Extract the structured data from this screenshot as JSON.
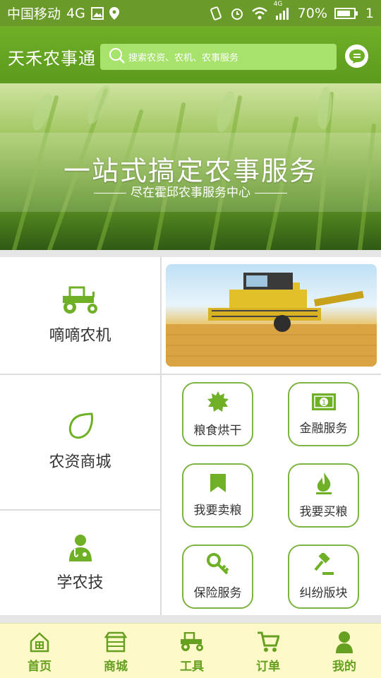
{
  "status_bar": {
    "carrier": "中国移动",
    "network": "4G",
    "network_small": "4G",
    "battery": "70%",
    "time_partial": "1"
  },
  "header": {
    "title": "天禾农事通",
    "search_placeholder": "搜索农资、农机、农事服务"
  },
  "banner": {
    "title": "一站式搞定农事服务",
    "subtitle": "尽在霍邱农事服务中心"
  },
  "categories": [
    {
      "label": "嘀嘀农机",
      "icon": "tractor-icon"
    },
    {
      "label": "农资商城",
      "icon": "lemon-icon"
    },
    {
      "label": "学农技",
      "icon": "doctor-icon"
    }
  ],
  "services": [
    {
      "label": "粮食烘干",
      "icon": "sun-burst-icon"
    },
    {
      "label": "金融服务",
      "icon": "banknote-icon"
    },
    {
      "label": "我要卖粮",
      "icon": "bookmark-icon"
    },
    {
      "label": "我要买粮",
      "icon": "fire-icon"
    },
    {
      "label": "保险服务",
      "icon": "key-icon"
    },
    {
      "label": "纠纷版块",
      "icon": "gavel-icon"
    }
  ],
  "bottom_nav": [
    {
      "label": "首页",
      "icon": "home-icon"
    },
    {
      "label": "商城",
      "icon": "store-icon"
    },
    {
      "label": "工具",
      "icon": "tractor-icon"
    },
    {
      "label": "订单",
      "icon": "cart-icon"
    },
    {
      "label": "我的",
      "icon": "user-icon"
    }
  ],
  "colors": {
    "brand_green": "#6fb027",
    "accent_green": "#7cb342",
    "nav_bg": "#fef9c8",
    "nav_text": "#66a020"
  }
}
